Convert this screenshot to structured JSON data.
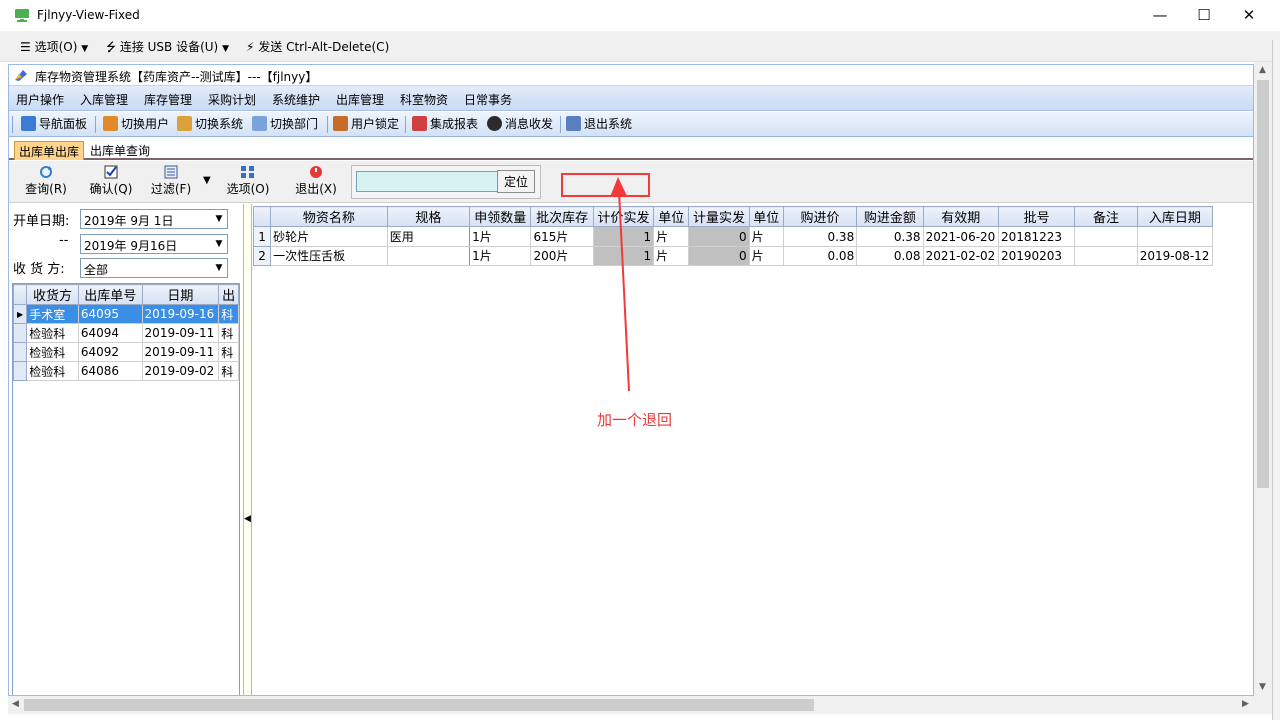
{
  "window": {
    "title": "Fjlnyy-View-Fixed",
    "controls": {
      "minimize": "—",
      "maximize": "☐",
      "close": "✕"
    }
  },
  "rdp_bar": {
    "options": "选项(O)",
    "usb": "连接 USB 设备(U)",
    "cad": "发送 Ctrl-Alt-Delete(C)"
  },
  "app": {
    "title": "库存物资管理系统【药库资产--测试库】---【fjlnyy】",
    "menu": [
      "用户操作",
      "入库管理",
      "库存管理",
      "采购计划",
      "系统维护",
      "出库管理",
      "科室物资",
      "日常事务"
    ],
    "toolbar": [
      {
        "label": "导航面板",
        "icon": "grid-icon",
        "color": "#3b7bd6"
      },
      {
        "label": "切换用户",
        "icon": "users-icon",
        "color": "#e08a2b"
      },
      {
        "label": "切换系统",
        "icon": "switch-system-icon",
        "color": "#d9a23a"
      },
      {
        "label": "切换部门",
        "icon": "calendar-icon",
        "color": "#7aa3d9"
      },
      {
        "label": "用户锁定",
        "icon": "user-lock-icon",
        "color": "#c76b2a"
      },
      {
        "label": "集成报表",
        "icon": "report-icon",
        "color": "#d04040"
      },
      {
        "label": "消息收发",
        "icon": "info-icon",
        "color": "#2b2b2b"
      },
      {
        "label": "退出系统",
        "icon": "exit-icon",
        "color": "#5a7fc0"
      }
    ],
    "tabs": [
      "出库单出库",
      "出库单查询"
    ],
    "commands": [
      {
        "label": "查询(R)",
        "icon": "refresh-icon"
      },
      {
        "label": "确认(Q)",
        "icon": "checkbox-icon"
      },
      {
        "label": "过滤(F)",
        "icon": "filter-icon"
      },
      {
        "label": "选项(O)",
        "icon": "options-icon"
      },
      {
        "label": "退出(X)",
        "icon": "power-icon"
      }
    ],
    "search": {
      "value": "",
      "button": "定位"
    },
    "filters": {
      "start_label": "开单日期:",
      "start_date": "2019年 9月 1日",
      "end_label": "--",
      "end_date": "2019年 9月16日",
      "receiver_label": "收 货 方:",
      "receiver": "全部"
    },
    "orders": {
      "columns": [
        "收货方",
        "出库单号",
        "日期",
        "出"
      ],
      "rows": [
        [
          "手术室",
          "64095",
          "2019-09-16",
          "科"
        ],
        [
          "检验科",
          "64094",
          "2019-09-11",
          "科"
        ],
        [
          "检验科",
          "64092",
          "2019-09-11",
          "科"
        ],
        [
          "检验科",
          "64086",
          "2019-09-02",
          "科"
        ]
      ]
    },
    "items": {
      "columns": [
        "物资名称",
        "规格",
        "申领数量",
        "批次库存",
        "计价实发",
        "单位",
        "计量实发",
        "单位",
        "购进价",
        "购进金额",
        "有效期",
        "批号",
        "备注",
        "入库日期"
      ],
      "rows": [
        [
          "1",
          "砂轮片",
          "医用",
          "1片",
          "615片",
          "1",
          "片",
          "0",
          "片",
          "0.38",
          "0.38",
          "2021-06-20",
          "20181223",
          "",
          ""
        ],
        [
          "2",
          "一次性压舌板",
          "",
          "1片",
          "200片",
          "1",
          "片",
          "0",
          "片",
          "0.08",
          "0.08",
          "2021-02-02",
          "20190203",
          "",
          "2019-08-12"
        ]
      ]
    }
  },
  "annotation": {
    "text": "加一个退回",
    "color": "#ea3a3a"
  }
}
